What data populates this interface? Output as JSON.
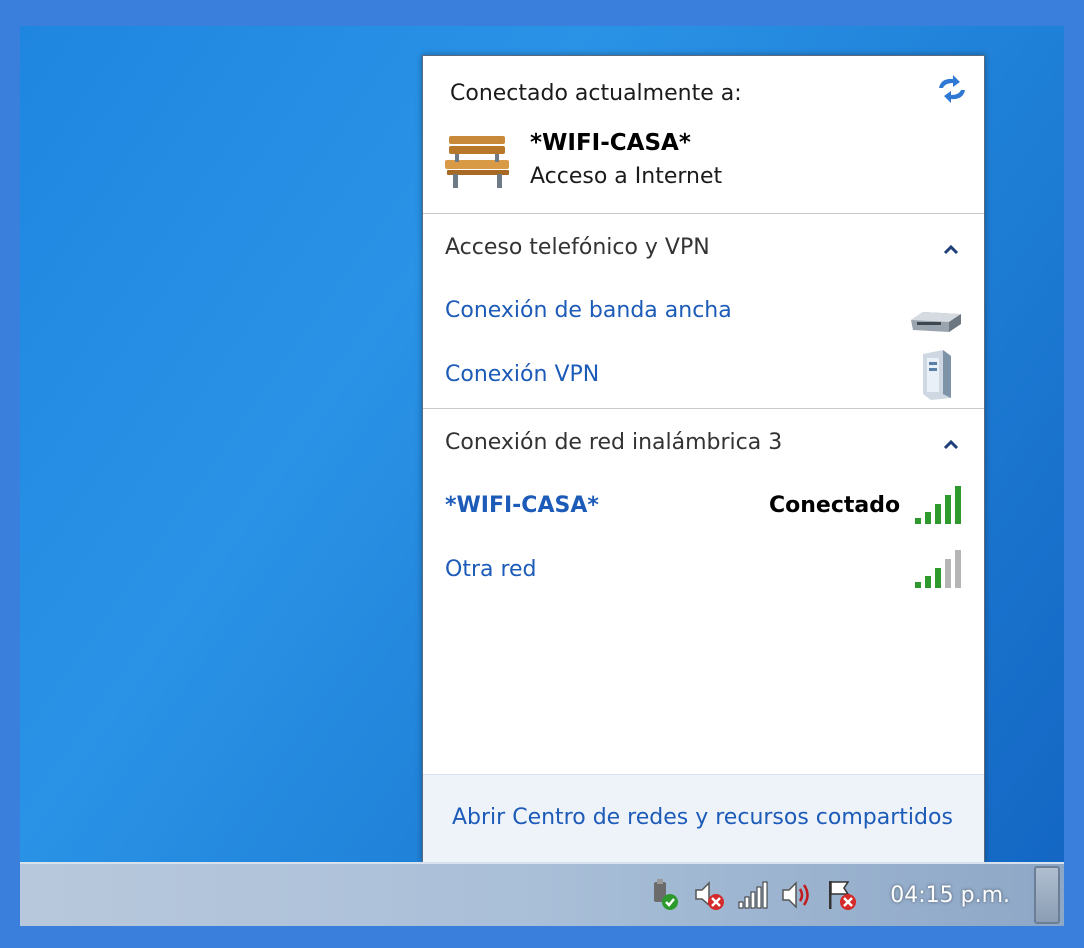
{
  "flyout": {
    "header_title": "Conectado actualmente a:",
    "current": {
      "name": "*WIFI-CASA*",
      "status": "Acceso a Internet",
      "icon": "park-bench-network-icon"
    },
    "sections": [
      {
        "title": "Acceso telefónico y VPN",
        "items": [
          {
            "label": "Conexión de banda ancha",
            "icon": "broadband-modem-icon"
          },
          {
            "label": "Conexión VPN",
            "icon": "vpn-server-icon"
          }
        ]
      },
      {
        "title": "Conexión de red inalámbrica 3",
        "items": [
          {
            "label": "*WIFI-CASA*",
            "status": "Conectado",
            "signal_bars": 5,
            "icon": "wifi-signal-icon"
          },
          {
            "label": "Otra red",
            "signal_bars": 3,
            "icon": "wifi-signal-icon"
          }
        ]
      }
    ],
    "footer_link": "Abrir Centro de redes y recursos compartidos"
  },
  "taskbar": {
    "tray_icons": [
      "usb-safe-remove-icon",
      "speaker-muted-error-icon",
      "network-signal-icon",
      "volume-icon",
      "action-center-flag-error-icon"
    ],
    "clock": "04:15 p.m."
  },
  "colors": {
    "link": "#1c5bb8",
    "desktop": "#1f86e0",
    "signal_green": "#2e9a2e"
  }
}
